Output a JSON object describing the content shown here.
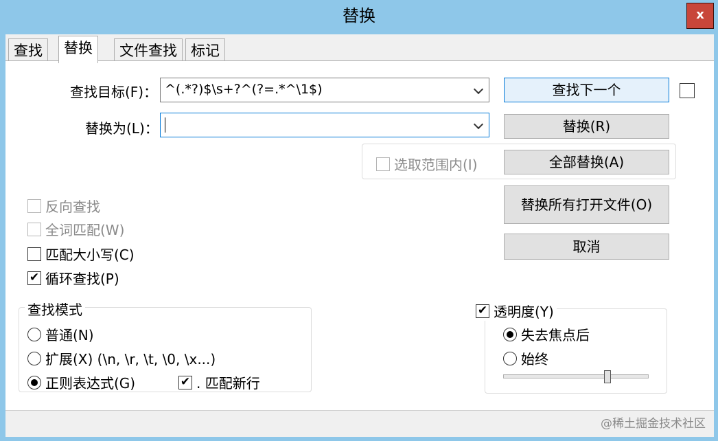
{
  "window": {
    "title": "替换",
    "close_label": "x"
  },
  "tabs": [
    {
      "label": "查找",
      "active": false
    },
    {
      "label": "替换",
      "active": true
    },
    {
      "label": "文件查找",
      "active": false
    },
    {
      "label": "标记",
      "active": false
    }
  ],
  "find": {
    "label": "查找目标(F)：",
    "value": "^(.*?)$\\s+?^(?=.*^\\1$)"
  },
  "replace": {
    "label": "替换为(L)：",
    "value": ""
  },
  "buttons": {
    "find_next": "查找下一个",
    "replace": "替换(R)",
    "replace_all": "全部替换(A)",
    "replace_all_open": "替换所有打开文件(O)",
    "cancel": "取消"
  },
  "in_selection": {
    "label": "选取范围内(I)",
    "checked": false,
    "enabled": false
  },
  "options": [
    {
      "label": "反向查找",
      "checked": false,
      "enabled": false
    },
    {
      "label": "全词匹配(W)",
      "checked": false,
      "enabled": false
    },
    {
      "label": "匹配大小写(C)",
      "checked": false,
      "enabled": true
    },
    {
      "label": "循环查找(P)",
      "checked": true,
      "enabled": true
    }
  ],
  "search_mode": {
    "legend": "查找模式",
    "normal": "普通(N)",
    "extended": "扩展(X) (\\n, \\r, \\t, \\0, \\x...)",
    "regex": "正则表达式(G)",
    "dot_newline": ". 匹配新行",
    "selected": "regex",
    "dot_newline_checked": true
  },
  "transparency": {
    "legend": "透明度(Y)",
    "checked": true,
    "on_lose_focus": "失去焦点后",
    "always": "始终",
    "selected": "on_lose_focus",
    "slider_value": 0.7
  },
  "watermark": "@稀土掘金技术社区",
  "colors": {
    "title_bar": "#8ec7e9",
    "close_button": "#c8463a",
    "focus_border": "#0078d7"
  }
}
